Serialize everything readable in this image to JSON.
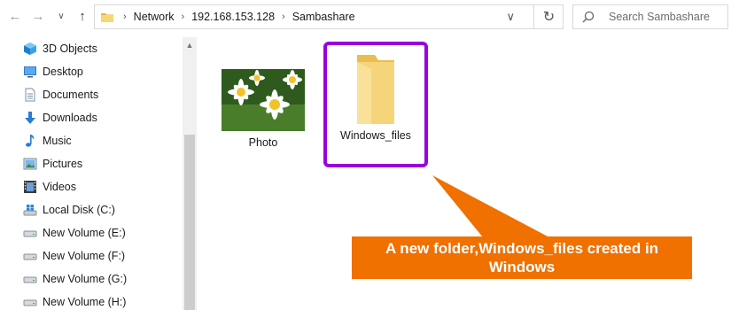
{
  "breadcrumb": {
    "items": [
      "Network",
      "192.168.153.128",
      "Sambashare"
    ]
  },
  "search": {
    "placeholder": "Search Sambashare"
  },
  "sidebar": {
    "items": [
      {
        "label": "3D Objects",
        "icon": "3d-objects-icon"
      },
      {
        "label": "Desktop",
        "icon": "desktop-icon"
      },
      {
        "label": "Documents",
        "icon": "documents-icon"
      },
      {
        "label": "Downloads",
        "icon": "downloads-icon"
      },
      {
        "label": "Music",
        "icon": "music-icon"
      },
      {
        "label": "Pictures",
        "icon": "pictures-icon"
      },
      {
        "label": "Videos",
        "icon": "videos-icon"
      },
      {
        "label": "Local Disk (C:)",
        "icon": "local-disk-icon"
      },
      {
        "label": "New Volume (E:)",
        "icon": "drive-icon"
      },
      {
        "label": "New Volume (F:)",
        "icon": "drive-icon"
      },
      {
        "label": "New Volume (G:)",
        "icon": "drive-icon"
      },
      {
        "label": "New Volume (H:)",
        "icon": "drive-icon"
      }
    ]
  },
  "content": {
    "items": [
      {
        "name": "Photo",
        "type": "image"
      },
      {
        "name": "Windows_files",
        "type": "folder"
      }
    ]
  },
  "annotation": {
    "text": "A new folder,Windows_files created in Windows",
    "color": "#f07000",
    "highlight_color": "#9900e0"
  }
}
